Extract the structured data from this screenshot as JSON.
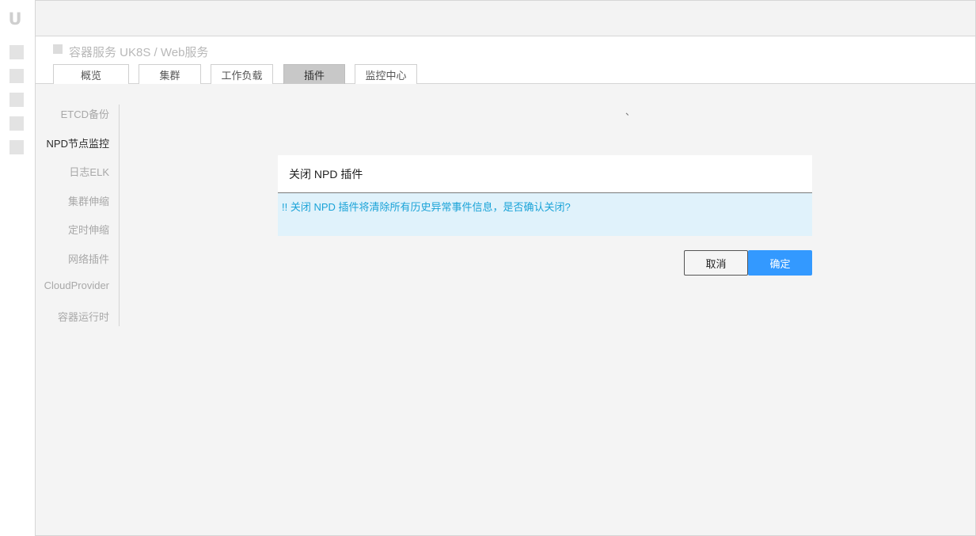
{
  "logo": {
    "text": "U"
  },
  "breadcrumb": {
    "text": "容器服务 UK8S / Web服务"
  },
  "tabs": [
    {
      "label": "概览"
    },
    {
      "label": "集群"
    },
    {
      "label": "工作负载"
    },
    {
      "label": "插件",
      "active": true
    },
    {
      "label": "监控中心"
    }
  ],
  "subnav": [
    {
      "label": "ETCD备份"
    },
    {
      "label": "NPD节点监控",
      "active": true
    },
    {
      "label": "日志ELK"
    },
    {
      "label": "集群伸缩"
    },
    {
      "label": "定时伸缩"
    },
    {
      "label": "网络插件"
    },
    {
      "label": "CloudProvider"
    },
    {
      "label": "容器运行时"
    }
  ],
  "stray_mark": "、",
  "dialog": {
    "title": "关闭 NPD 插件",
    "message": "!! 关闭 NPD 插件将清除所有历史异常事件信息，是否确认关闭?",
    "cancel_label": "取消",
    "confirm_label": "确定"
  },
  "colors": {
    "primary": "#3399ff",
    "info_bg": "#e0f2fb",
    "info_text": "#1aa3d8",
    "active_tab": "#c8c8c8"
  }
}
